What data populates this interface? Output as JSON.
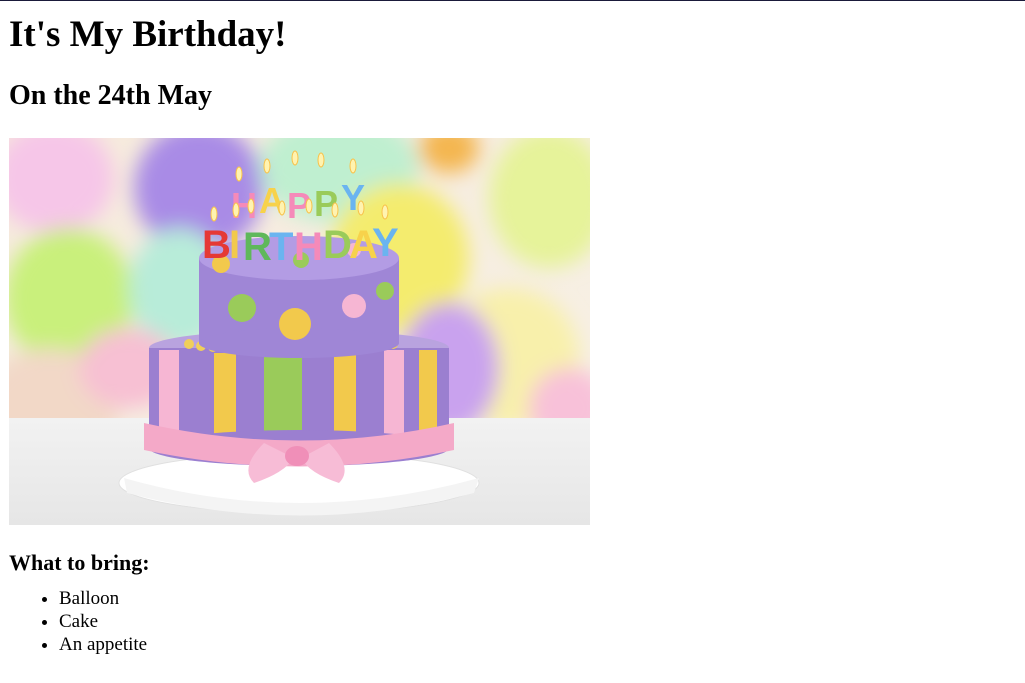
{
  "page": {
    "title": "It's My Birthday!",
    "subtitle": "On the 24th May",
    "image": {
      "alt": "birthday cake",
      "candle_text_top": "HAPPY",
      "candle_text_bottom": "BIRTHDAY"
    },
    "bring_heading": "What to bring:",
    "bring_items": [
      "Balloon",
      "Cake",
      "An appetite"
    ]
  },
  "colors": {
    "text": "#000000",
    "background": "#ffffff",
    "cake_purple": "#9b7fd0",
    "ribbon_pink": "#f4a9c8",
    "dot_yellow": "#f2c94c",
    "dot_green": "#9acb5a"
  }
}
